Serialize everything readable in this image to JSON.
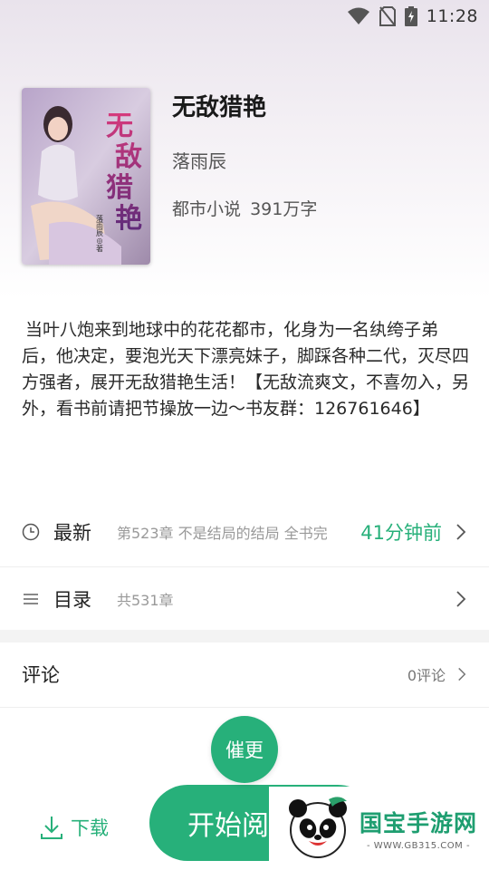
{
  "status_bar": {
    "time": "11:28"
  },
  "book": {
    "title": "无敌猎艳",
    "author": "落雨辰",
    "category": "都市小说",
    "word_count": "391万字",
    "cover": {
      "title_art": "无敌猎艳",
      "cover_author": "落雨辰◎著"
    },
    "description": "当叶八炮来到地球中的花花都市，化身为一名纨绔子弟后，他决定，要泡光天下漂亮妹子，脚踩各种二代，灭尽四方强者，展开无敌猎艳生活！【无敌流爽文，不喜勿入，另外，看书前请把节操放一边～书友群：126761646】"
  },
  "latest": {
    "label": "最新",
    "chapter": "第523章 不是结局的结局 全书完",
    "time": "41分钟前"
  },
  "toc": {
    "label": "目录",
    "count": "共531章"
  },
  "comments": {
    "label": "评论",
    "count": "0评论"
  },
  "actions": {
    "urge_label": "催更",
    "download_label": "下载",
    "start_label": "开始阅读"
  },
  "watermark": {
    "title": "国宝手游网",
    "url": "- WWW.GB315.COM -"
  },
  "colors": {
    "accent": "#27b07a"
  }
}
